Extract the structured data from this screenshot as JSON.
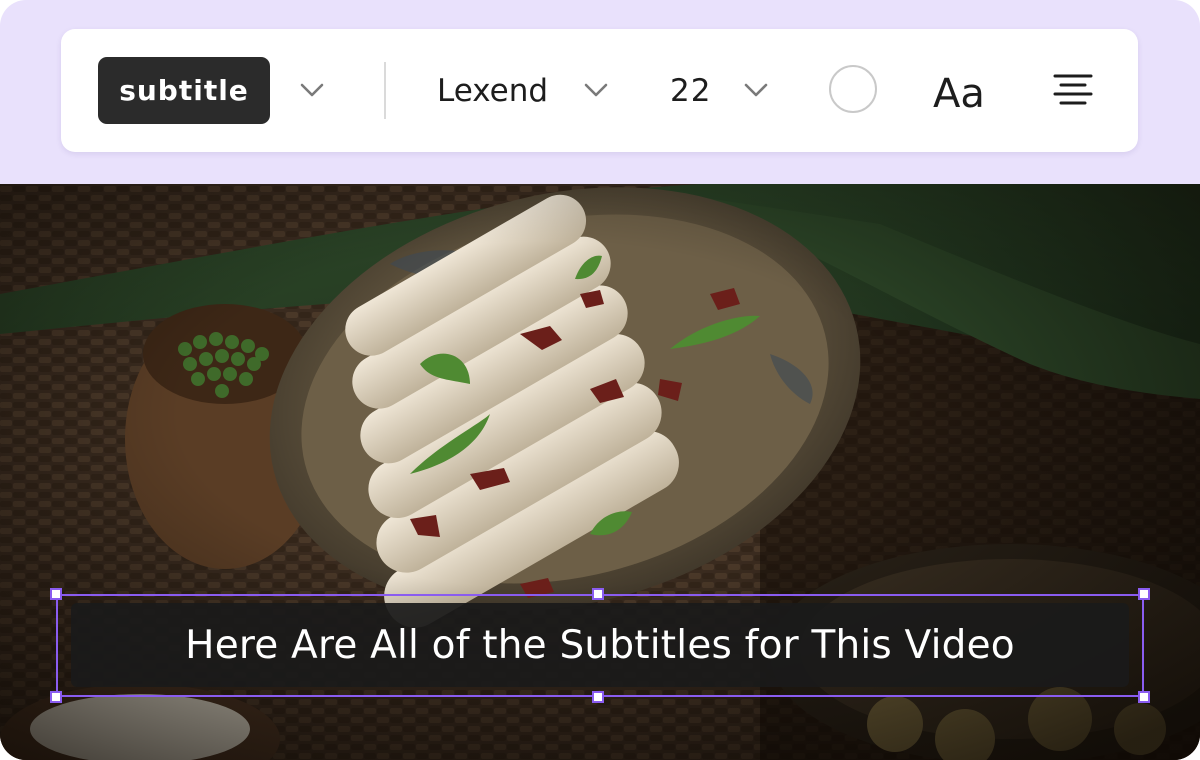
{
  "toolbar": {
    "style_label": "subtitle",
    "font_family": "Lexend",
    "font_size": "22",
    "text_color": "#ffffff",
    "case_label": "Aa",
    "alignment": "center"
  },
  "subtitle": {
    "text": "Here Are All of the Subtitles for This Video"
  },
  "colors": {
    "background": "#e9e1fc",
    "selection_accent": "#8a5cf0",
    "pill_background": "#2b2b2b"
  },
  "icons": {
    "style_dropdown": "chevron-down-icon",
    "font_dropdown": "chevron-down-icon",
    "size_dropdown": "chevron-down-icon",
    "color": "color-circle-icon",
    "case": "text-case-icon",
    "align": "align-center-icon"
  }
}
